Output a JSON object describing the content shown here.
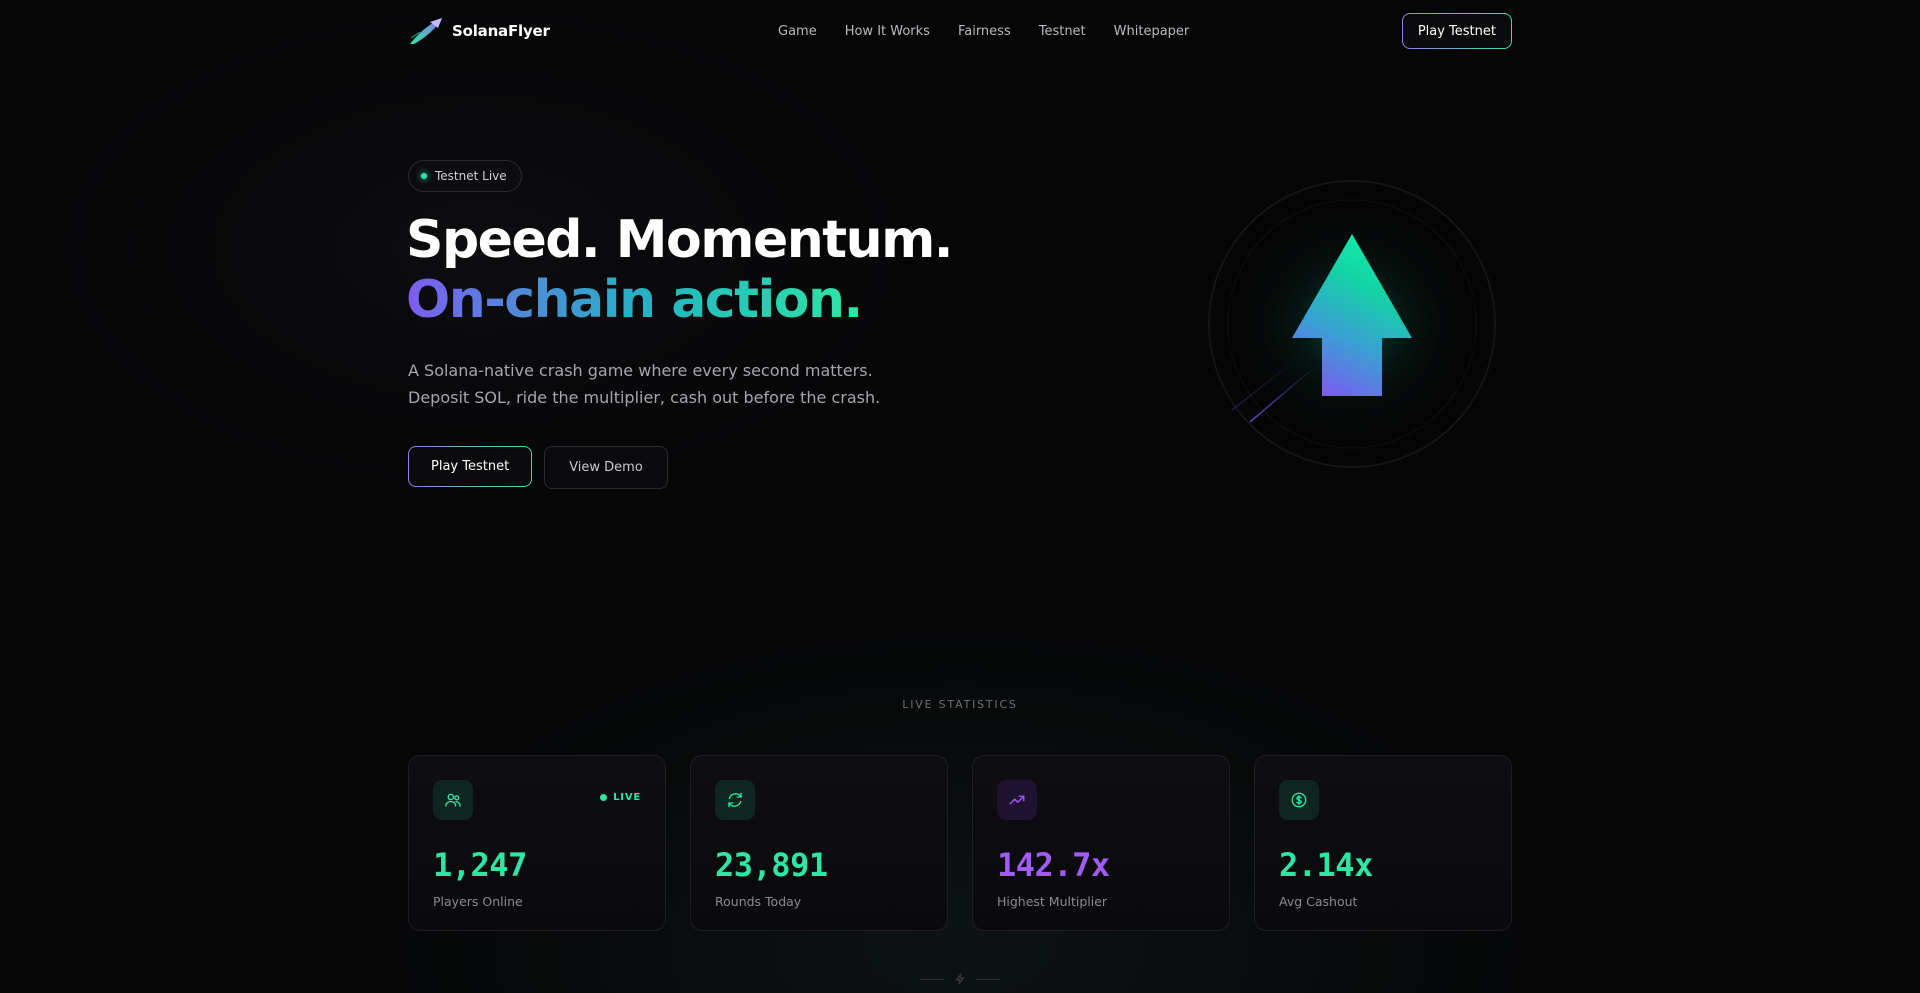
{
  "brand": {
    "name": "SolanaFlyer"
  },
  "nav": {
    "items": [
      {
        "label": "Game"
      },
      {
        "label": "How It Works"
      },
      {
        "label": "Fairness"
      },
      {
        "label": "Testnet"
      },
      {
        "label": "Whitepaper"
      }
    ],
    "cta_label": "Play Testnet"
  },
  "hero": {
    "badge": "Testnet Live",
    "title_line1": "Speed. Momentum.",
    "title_line2": "On-chain action.",
    "description_line1": "A Solana-native crash game where every second matters.",
    "description_line2": "Deposit SOL, ride the multiplier, cash out before the crash.",
    "primary_label": "Play Testnet",
    "secondary_label": "View Demo"
  },
  "stats": {
    "section_label": "LIVE STATISTICS",
    "live_label": "LIVE",
    "items": [
      {
        "value": "1,247",
        "label": "Players Online",
        "icon": "users-icon"
      },
      {
        "value": "23,891",
        "label": "Rounds Today",
        "icon": "refresh-icon"
      },
      {
        "value": "142.7x",
        "label": "Highest Multiplier",
        "icon": "trending-up-icon"
      },
      {
        "value": "2.14x",
        "label": "Avg Cashout",
        "icon": "dollar-circle-icon"
      }
    ]
  },
  "colors": {
    "accent_green": "#2ee6a4",
    "accent_purple": "#a05cf4",
    "background": "#050506"
  }
}
